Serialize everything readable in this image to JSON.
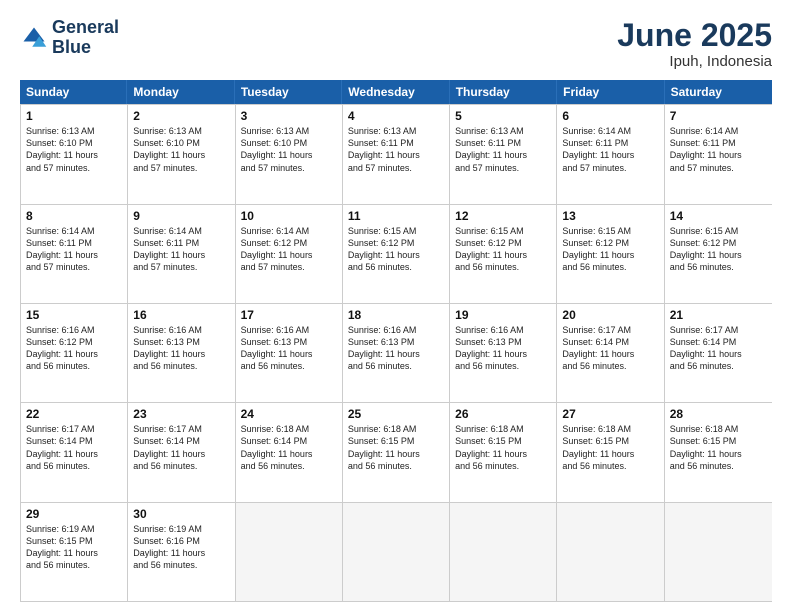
{
  "header": {
    "logo_line1": "General",
    "logo_line2": "Blue",
    "month": "June 2025",
    "location": "Ipuh, Indonesia"
  },
  "weekdays": [
    "Sunday",
    "Monday",
    "Tuesday",
    "Wednesday",
    "Thursday",
    "Friday",
    "Saturday"
  ],
  "weeks": [
    [
      {
        "day": "1",
        "lines": [
          "Sunrise: 6:13 AM",
          "Sunset: 6:10 PM",
          "Daylight: 11 hours",
          "and 57 minutes."
        ]
      },
      {
        "day": "2",
        "lines": [
          "Sunrise: 6:13 AM",
          "Sunset: 6:10 PM",
          "Daylight: 11 hours",
          "and 57 minutes."
        ]
      },
      {
        "day": "3",
        "lines": [
          "Sunrise: 6:13 AM",
          "Sunset: 6:10 PM",
          "Daylight: 11 hours",
          "and 57 minutes."
        ]
      },
      {
        "day": "4",
        "lines": [
          "Sunrise: 6:13 AM",
          "Sunset: 6:11 PM",
          "Daylight: 11 hours",
          "and 57 minutes."
        ]
      },
      {
        "day": "5",
        "lines": [
          "Sunrise: 6:13 AM",
          "Sunset: 6:11 PM",
          "Daylight: 11 hours",
          "and 57 minutes."
        ]
      },
      {
        "day": "6",
        "lines": [
          "Sunrise: 6:14 AM",
          "Sunset: 6:11 PM",
          "Daylight: 11 hours",
          "and 57 minutes."
        ]
      },
      {
        "day": "7",
        "lines": [
          "Sunrise: 6:14 AM",
          "Sunset: 6:11 PM",
          "Daylight: 11 hours",
          "and 57 minutes."
        ]
      }
    ],
    [
      {
        "day": "8",
        "lines": [
          "Sunrise: 6:14 AM",
          "Sunset: 6:11 PM",
          "Daylight: 11 hours",
          "and 57 minutes."
        ]
      },
      {
        "day": "9",
        "lines": [
          "Sunrise: 6:14 AM",
          "Sunset: 6:11 PM",
          "Daylight: 11 hours",
          "and 57 minutes."
        ]
      },
      {
        "day": "10",
        "lines": [
          "Sunrise: 6:14 AM",
          "Sunset: 6:12 PM",
          "Daylight: 11 hours",
          "and 57 minutes."
        ]
      },
      {
        "day": "11",
        "lines": [
          "Sunrise: 6:15 AM",
          "Sunset: 6:12 PM",
          "Daylight: 11 hours",
          "and 56 minutes."
        ]
      },
      {
        "day": "12",
        "lines": [
          "Sunrise: 6:15 AM",
          "Sunset: 6:12 PM",
          "Daylight: 11 hours",
          "and 56 minutes."
        ]
      },
      {
        "day": "13",
        "lines": [
          "Sunrise: 6:15 AM",
          "Sunset: 6:12 PM",
          "Daylight: 11 hours",
          "and 56 minutes."
        ]
      },
      {
        "day": "14",
        "lines": [
          "Sunrise: 6:15 AM",
          "Sunset: 6:12 PM",
          "Daylight: 11 hours",
          "and 56 minutes."
        ]
      }
    ],
    [
      {
        "day": "15",
        "lines": [
          "Sunrise: 6:16 AM",
          "Sunset: 6:12 PM",
          "Daylight: 11 hours",
          "and 56 minutes."
        ]
      },
      {
        "day": "16",
        "lines": [
          "Sunrise: 6:16 AM",
          "Sunset: 6:13 PM",
          "Daylight: 11 hours",
          "and 56 minutes."
        ]
      },
      {
        "day": "17",
        "lines": [
          "Sunrise: 6:16 AM",
          "Sunset: 6:13 PM",
          "Daylight: 11 hours",
          "and 56 minutes."
        ]
      },
      {
        "day": "18",
        "lines": [
          "Sunrise: 6:16 AM",
          "Sunset: 6:13 PM",
          "Daylight: 11 hours",
          "and 56 minutes."
        ]
      },
      {
        "day": "19",
        "lines": [
          "Sunrise: 6:16 AM",
          "Sunset: 6:13 PM",
          "Daylight: 11 hours",
          "and 56 minutes."
        ]
      },
      {
        "day": "20",
        "lines": [
          "Sunrise: 6:17 AM",
          "Sunset: 6:14 PM",
          "Daylight: 11 hours",
          "and 56 minutes."
        ]
      },
      {
        "day": "21",
        "lines": [
          "Sunrise: 6:17 AM",
          "Sunset: 6:14 PM",
          "Daylight: 11 hours",
          "and 56 minutes."
        ]
      }
    ],
    [
      {
        "day": "22",
        "lines": [
          "Sunrise: 6:17 AM",
          "Sunset: 6:14 PM",
          "Daylight: 11 hours",
          "and 56 minutes."
        ]
      },
      {
        "day": "23",
        "lines": [
          "Sunrise: 6:17 AM",
          "Sunset: 6:14 PM",
          "Daylight: 11 hours",
          "and 56 minutes."
        ]
      },
      {
        "day": "24",
        "lines": [
          "Sunrise: 6:18 AM",
          "Sunset: 6:14 PM",
          "Daylight: 11 hours",
          "and 56 minutes."
        ]
      },
      {
        "day": "25",
        "lines": [
          "Sunrise: 6:18 AM",
          "Sunset: 6:15 PM",
          "Daylight: 11 hours",
          "and 56 minutes."
        ]
      },
      {
        "day": "26",
        "lines": [
          "Sunrise: 6:18 AM",
          "Sunset: 6:15 PM",
          "Daylight: 11 hours",
          "and 56 minutes."
        ]
      },
      {
        "day": "27",
        "lines": [
          "Sunrise: 6:18 AM",
          "Sunset: 6:15 PM",
          "Daylight: 11 hours",
          "and 56 minutes."
        ]
      },
      {
        "day": "28",
        "lines": [
          "Sunrise: 6:18 AM",
          "Sunset: 6:15 PM",
          "Daylight: 11 hours",
          "and 56 minutes."
        ]
      }
    ],
    [
      {
        "day": "29",
        "lines": [
          "Sunrise: 6:19 AM",
          "Sunset: 6:15 PM",
          "Daylight: 11 hours",
          "and 56 minutes."
        ]
      },
      {
        "day": "30",
        "lines": [
          "Sunrise: 6:19 AM",
          "Sunset: 6:16 PM",
          "Daylight: 11 hours",
          "and 56 minutes."
        ]
      },
      {
        "day": "",
        "lines": []
      },
      {
        "day": "",
        "lines": []
      },
      {
        "day": "",
        "lines": []
      },
      {
        "day": "",
        "lines": []
      },
      {
        "day": "",
        "lines": []
      }
    ]
  ]
}
